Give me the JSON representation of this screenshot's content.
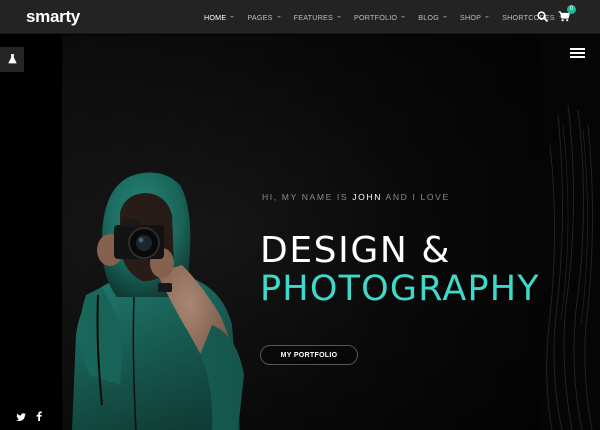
{
  "brand": {
    "logo": "smarty"
  },
  "nav": {
    "items": [
      {
        "label": "HOME",
        "active": true
      },
      {
        "label": "PAGES",
        "active": false
      },
      {
        "label": "FEATURES",
        "active": false
      },
      {
        "label": "PORTFOLIO",
        "active": false
      },
      {
        "label": "BLOG",
        "active": false
      },
      {
        "label": "SHOP",
        "active": false
      },
      {
        "label": "SHORTCODES",
        "active": false
      }
    ],
    "cart_count": "0"
  },
  "hero": {
    "intro_before": "HI, MY NAME IS",
    "intro_name": "JOHN",
    "intro_after": "AND I LOVE",
    "title_line1": "DESIGN &",
    "title_line2": "PHOTOGRAPHY",
    "cta_label": "MY PORTFOLIO"
  },
  "colors": {
    "accent": "#3fd9c9",
    "badge": "#1abc9c",
    "topbar": "#232323",
    "hoodie": "#1f7a6e"
  },
  "icons": [
    "search-icon",
    "cart-icon",
    "flask-icon",
    "twitter-icon",
    "facebook-icon",
    "menu-icon",
    "caret-down-icon"
  ]
}
